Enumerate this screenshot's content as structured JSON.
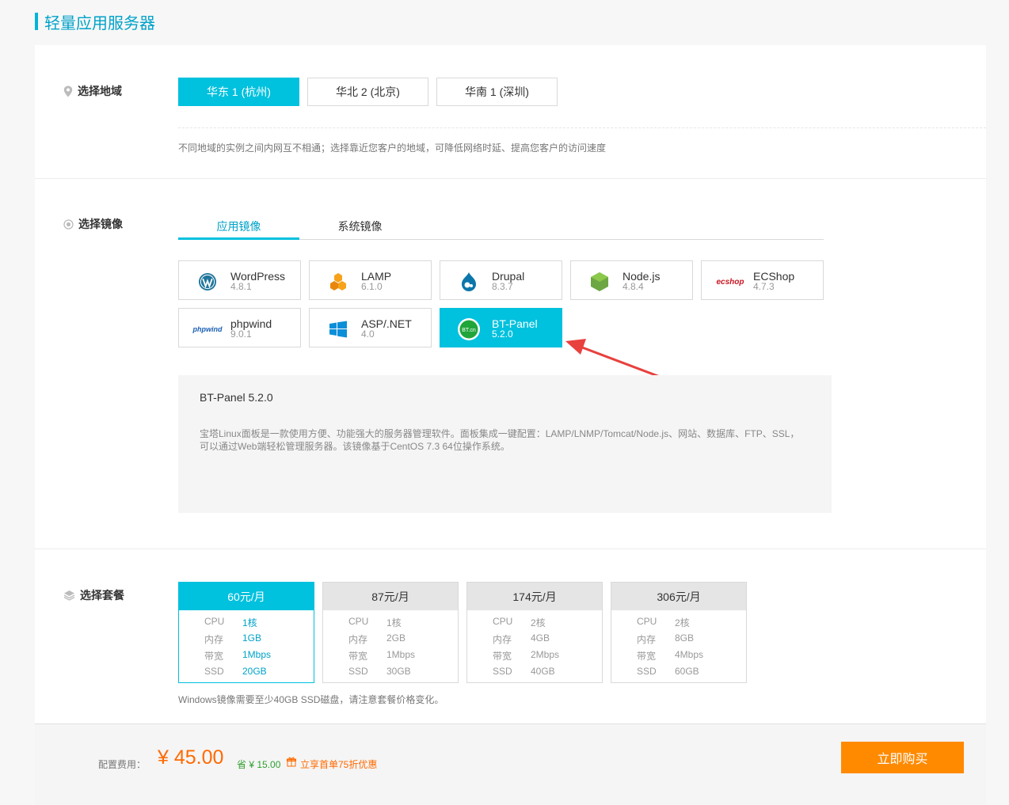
{
  "page_title": "轻量应用服务器",
  "region": {
    "label": "选择地域",
    "options": [
      "华东 1 (杭州)",
      "华北 2 (北京)",
      "华南 1 (深圳)"
    ],
    "selected": 0,
    "hint": "不同地域的实例之间内网互不相通；选择靠近您客户的地域，可降低网络时延、提高您客户的访问速度"
  },
  "image": {
    "label": "选择镜像",
    "tabs": [
      "应用镜像",
      "系统镜像"
    ],
    "active_tab": 0,
    "items": [
      {
        "name": "WordPress",
        "version": "4.8.1",
        "icon": "wordpress-icon"
      },
      {
        "name": "LAMP",
        "version": "6.1.0",
        "icon": "lamp-icon"
      },
      {
        "name": "Drupal",
        "version": "8.3.7",
        "icon": "drupal-icon"
      },
      {
        "name": "Node.js",
        "version": "4.8.4",
        "icon": "nodejs-icon"
      },
      {
        "name": "ECShop",
        "version": "4.7.3",
        "icon": "ecshop-icon"
      },
      {
        "name": "phpwind",
        "version": "9.0.1",
        "icon": "phpwind-icon"
      },
      {
        "name": "ASP/.NET",
        "version": "4.0",
        "icon": "windows-icon"
      },
      {
        "name": "BT-Panel",
        "version": "5.2.0",
        "icon": "bt-panel-icon"
      }
    ],
    "selected": 7,
    "logo_text": {
      "ecshop": "ecshop",
      "phpwind": "phpwind",
      "bt": "BT.cn"
    },
    "desc_title": "BT-Panel 5.2.0",
    "desc_line1": "宝塔Linux面板是一款使用方便、功能强大的服务器管理软件。面板集成一键配置：LAMP/LNMP/Tomcat/Node.js、网站、数据库、FTP、SSL，",
    "desc_line2": "可以通过Web端轻松管理服务器。该镜像基于CentOS 7.3 64位操作系统。"
  },
  "plan": {
    "label": "选择套餐",
    "row_labels": [
      "CPU",
      "内存",
      "带宽",
      "SSD"
    ],
    "items": [
      {
        "price": "60元/月",
        "cpu": "1核",
        "mem": "1GB",
        "bw": "1Mbps",
        "ssd": "20GB"
      },
      {
        "price": "87元/月",
        "cpu": "1核",
        "mem": "2GB",
        "bw": "1Mbps",
        "ssd": "30GB"
      },
      {
        "price": "174元/月",
        "cpu": "2核",
        "mem": "4GB",
        "bw": "2Mbps",
        "ssd": "40GB"
      },
      {
        "price": "306元/月",
        "cpu": "2核",
        "mem": "8GB",
        "bw": "4Mbps",
        "ssd": "60GB"
      }
    ],
    "selected": 0,
    "note": "Windows镜像需要至少40GB SSD磁盘，请注意套餐价格变化。"
  },
  "footer": {
    "fee_label": "配置费用：",
    "price": "¥ 45.00",
    "save": "省 ¥ 15.00",
    "promo": "立享首单75折优惠",
    "buy_label": "立即购买"
  },
  "colors": {
    "accent": "#00c1de",
    "buy": "#ff8a00",
    "price": "#ff6a00",
    "save": "#2e9f2e",
    "arrow": "#e8413e"
  }
}
